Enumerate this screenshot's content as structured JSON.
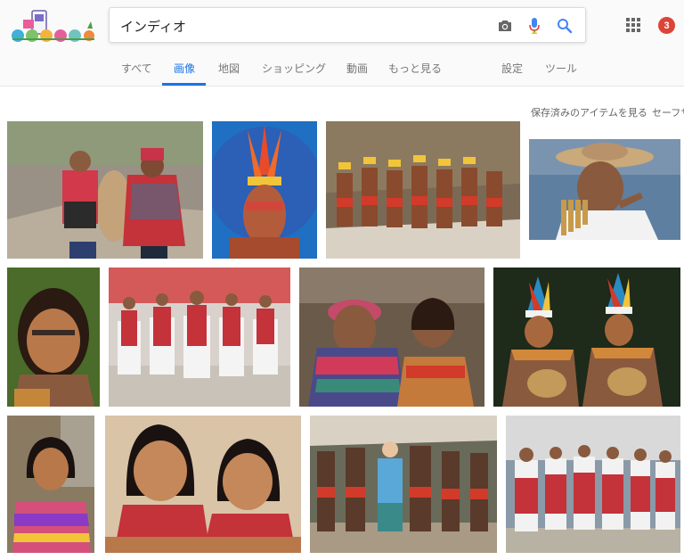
{
  "search": {
    "query": "インディオ"
  },
  "header": {
    "notifications_count": "3"
  },
  "tabs": [
    {
      "label": "すべて"
    },
    {
      "label": "画像",
      "active": true
    },
    {
      "label": "地図"
    },
    {
      "label": "ショッピング"
    },
    {
      "label": "動画"
    },
    {
      "label": "もっと見る"
    },
    {
      "label": "設定"
    },
    {
      "label": "ツール"
    }
  ],
  "toolbar": {
    "saved_label": "保存済みのアイテムを見る",
    "safesearch_label": "セーフサ"
  },
  "icons": [
    "camera-icon",
    "microphone-icon",
    "search-icon",
    "apps-grid-icon"
  ],
  "colors": {
    "accent": "#1a73e8",
    "badge": "#db4437",
    "mic_red": "#ea4335"
  }
}
